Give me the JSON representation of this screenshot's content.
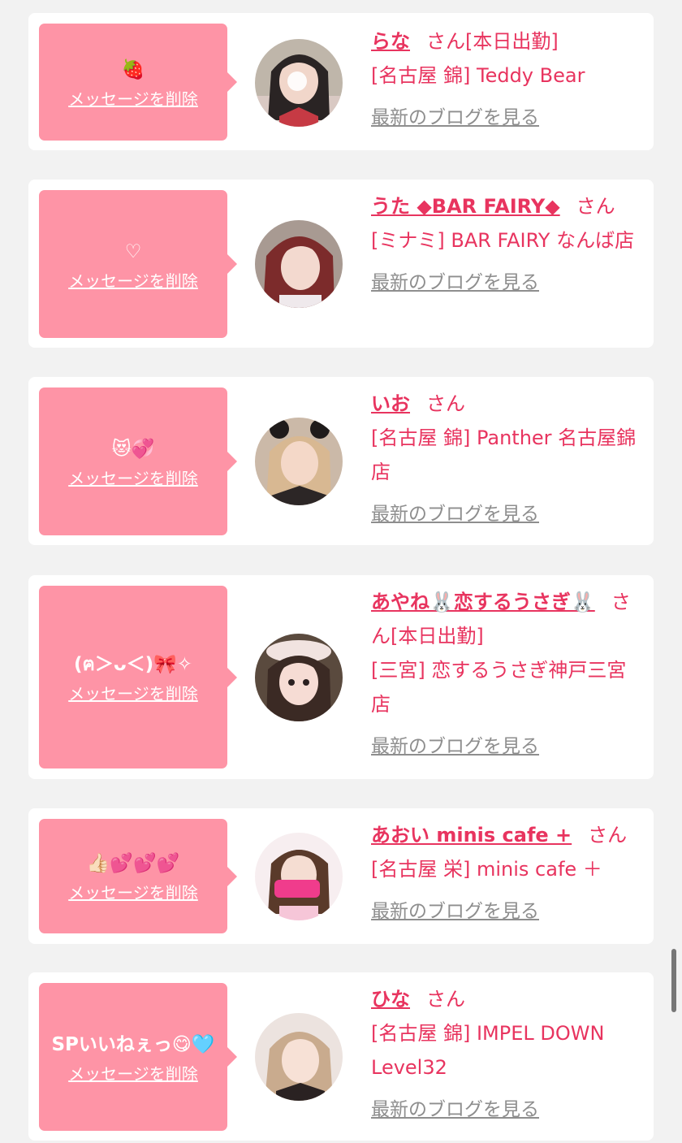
{
  "colors": {
    "background": "#f2f2f2",
    "card": "#ffffff",
    "bubble": "#fe94a6",
    "accent_text": "#e8345f",
    "link_gray": "#8e8e8e"
  },
  "delete_label": "メッセージを削除",
  "blog_label": "最新のブログを見る",
  "san_label": "さん",
  "entries": [
    {
      "message": "🍓",
      "name": "らな",
      "status": "[本日出勤]",
      "shop": "[名古屋 錦] Teddy Bear",
      "avatar_icon": "girl-avatar"
    },
    {
      "message": "♡",
      "name": "うた ◆BAR FAIRY◆",
      "status": "",
      "shop": "[ミナミ] BAR FAIRY なんば店",
      "avatar_icon": "girl-avatar"
    },
    {
      "message": "😻💞",
      "name": "いお",
      "status": "",
      "shop": "[名古屋 錦] Panther 名古屋錦店",
      "avatar_icon": "girl-avatar"
    },
    {
      "message": "(ฅ＞ᴗ＜)🎀✧",
      "name": "あやね🐰恋するうさぎ🐰",
      "status": "[本日出勤]",
      "shop": "[三宮] 恋するうさぎ神戸三宮店",
      "avatar_icon": "girl-avatar"
    },
    {
      "message": "👍🏻💕💕💕",
      "name": "あおい minis cafe +",
      "status": "",
      "shop": "[名古屋 栄] minis cafe ＋",
      "avatar_icon": "girl-avatar"
    },
    {
      "message": "SPいいねぇっ😋🩵",
      "name": "ひな",
      "status": "",
      "shop": "[名古屋 錦] IMPEL DOWN Level32",
      "avatar_icon": "girl-avatar"
    }
  ]
}
